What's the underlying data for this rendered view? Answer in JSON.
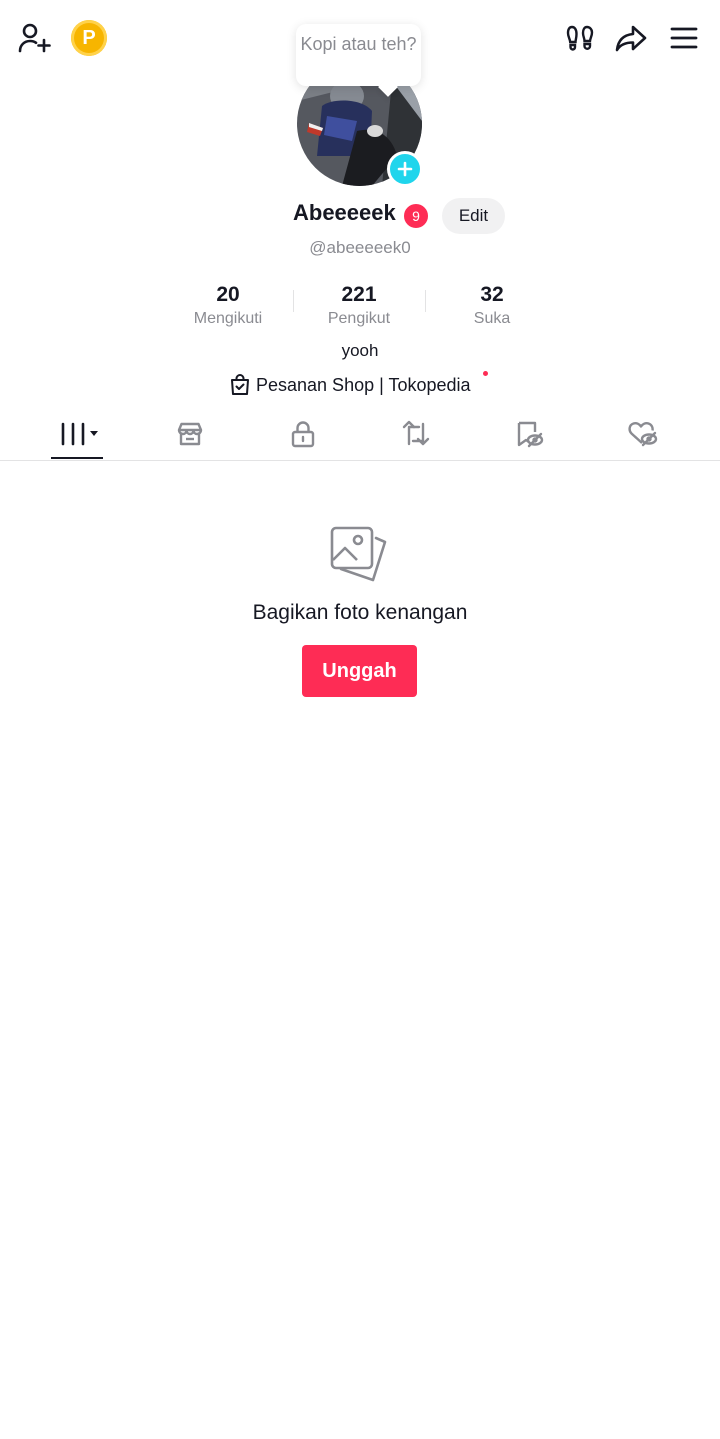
{
  "profile": {
    "tooltip_text": "Kopi atau teh?",
    "display_name": "Abeeeeek",
    "notification_count": "9",
    "edit_label": "Edit",
    "username": "@abeeeeek0",
    "bio": "yooh",
    "shop_link_label": "Pesanan Shop | Tokopedia"
  },
  "stats": [
    {
      "value": "20",
      "label": "Mengikuti"
    },
    {
      "value": "221",
      "label": "Pengikut"
    },
    {
      "value": "32",
      "label": "Suka"
    }
  ],
  "coin_label": "P",
  "tabs": [
    "videos",
    "shop",
    "private",
    "reposts",
    "favorites",
    "liked"
  ],
  "empty_state": {
    "title": "Bagikan foto kenangan",
    "button_label": "Unggah"
  },
  "colors": {
    "accent": "#fe2c55",
    "avatar_add": "#20d5ec",
    "coin": "#f7b500"
  }
}
